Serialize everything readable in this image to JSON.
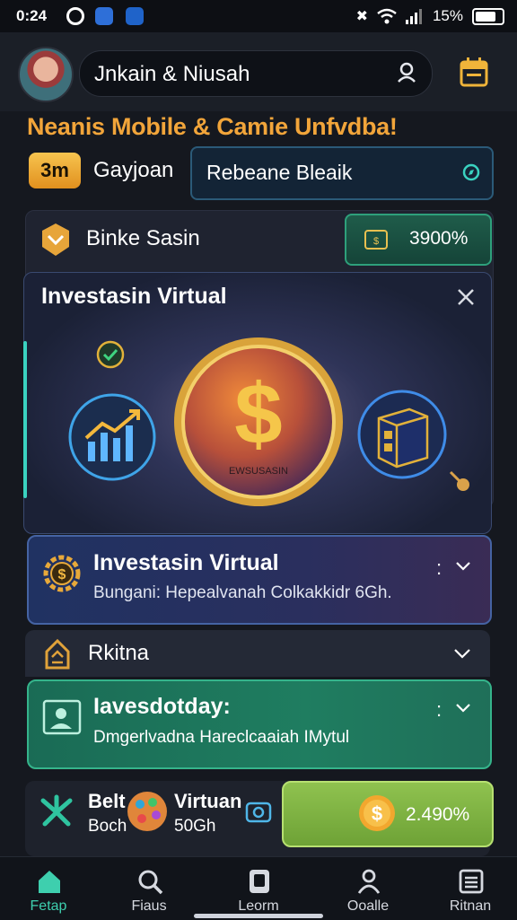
{
  "status": {
    "time": "0:24",
    "battery": "15%"
  },
  "header": {
    "search_value": "Jnkain & Niusah",
    "icons": [
      "user-icon",
      "calendar-icon"
    ]
  },
  "promo": {
    "text": "Neanis Mobile & Camie Unfvdba!"
  },
  "filter": {
    "badge": "3m",
    "label": "Gayjoan",
    "field_value": "Rebeane Bleaik"
  },
  "section": {
    "label": "Binke Sasin",
    "pct": "3900%"
  },
  "invest": {
    "title": "Investasin Virtual",
    "coin_text": "EWSUSASIN"
  },
  "info": {
    "title": "Investasin Virtual",
    "subtitle": "Bungani: Hepealvanah Colkakkidr 6Gh.",
    "more": ":"
  },
  "ritna": {
    "label": "Rkitna"
  },
  "green": {
    "title": "Iavesdotday:",
    "subtitle": "Dmgerlvadna Hareclcaaiah IMytul",
    "more": ":"
  },
  "bottom": {
    "col1_title": "Belt",
    "col1_sub": "Boch",
    "col2_title": "Virtuan",
    "col2_sub": "50Gh",
    "button_value": "2.490%"
  },
  "nav": {
    "items": [
      {
        "label": "Fetap",
        "active": true
      },
      {
        "label": "Fiaus",
        "active": false
      },
      {
        "label": "Leorm",
        "active": false
      },
      {
        "label": "Ooalle",
        "active": false
      },
      {
        "label": "Ritnan",
        "active": false
      }
    ]
  },
  "colors": {
    "accent": "#3ecfae",
    "promo": "#f2a53a",
    "gold": "#f0b43a",
    "green_card": "#1f7d60"
  }
}
